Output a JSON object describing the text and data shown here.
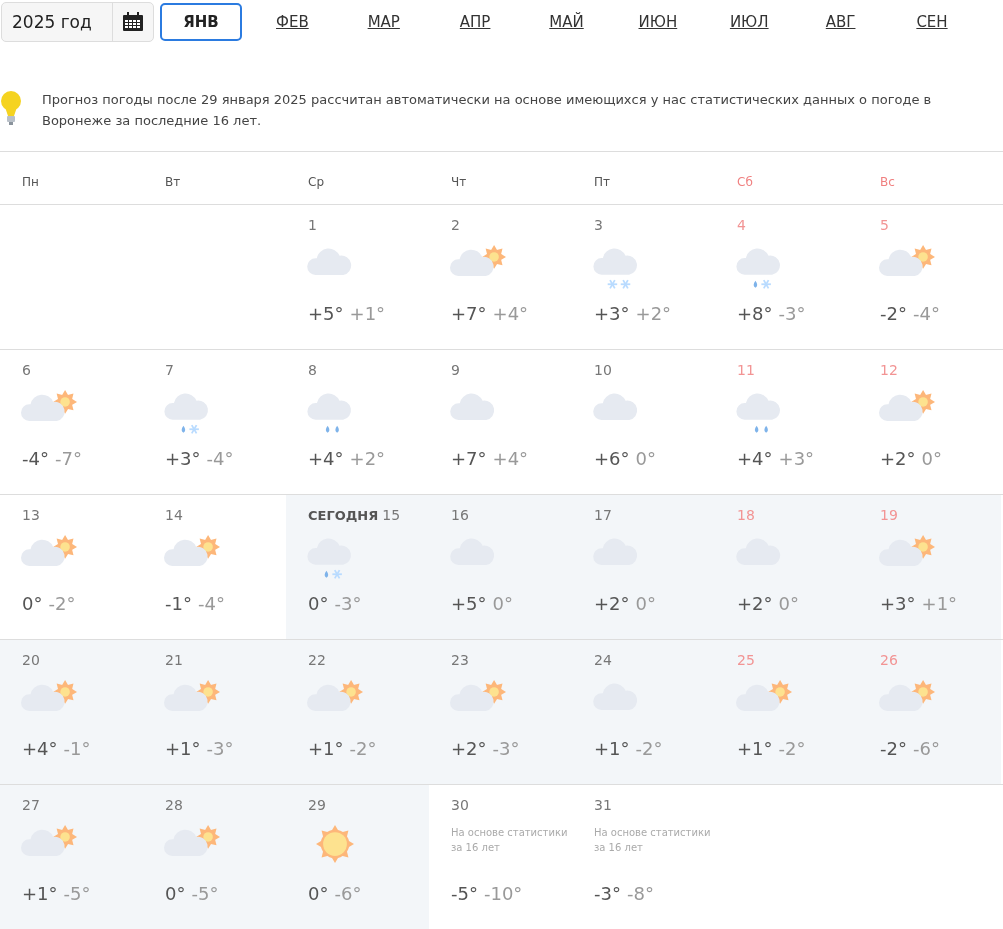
{
  "year_picker": {
    "value": "2025 год"
  },
  "months": [
    {
      "label": "ЯНВ",
      "selected": true
    },
    {
      "label": "ФЕВ",
      "selected": false
    },
    {
      "label": "МАР",
      "selected": false
    },
    {
      "label": "АПР",
      "selected": false
    },
    {
      "label": "МАЙ",
      "selected": false
    },
    {
      "label": "ИЮН",
      "selected": false
    },
    {
      "label": "ИЮЛ",
      "selected": false
    },
    {
      "label": "АВГ",
      "selected": false
    },
    {
      "label": "СЕН",
      "selected": false
    }
  ],
  "notice": "Прогноз погоды после 29 января 2025 рассчитан автоматически на основе имеющихся у нас статистических данных о погоде в Воронеже за последние 16 лет.",
  "weekdays": [
    {
      "label": "Пн",
      "weekend": false
    },
    {
      "label": "Вт",
      "weekend": false
    },
    {
      "label": "Ср",
      "weekend": false
    },
    {
      "label": "Чт",
      "weekend": false
    },
    {
      "label": "Пт",
      "weekend": false
    },
    {
      "label": "Сб",
      "weekend": true
    },
    {
      "label": "Вс",
      "weekend": true
    }
  ],
  "weeks": [
    {
      "kind": "leading",
      "days": [
        {
          "day": "1",
          "weekend": false,
          "highlighted": false,
          "kind": "cloud",
          "high": "+5°",
          "low": "+1°"
        },
        {
          "day": "2",
          "weekend": false,
          "highlighted": false,
          "kind": "partly",
          "high": "+7°",
          "low": "+4°"
        },
        {
          "day": "3",
          "weekend": false,
          "highlighted": false,
          "kind": "snow",
          "high": "+3°",
          "low": "+2°"
        },
        {
          "day": "4",
          "weekend": true,
          "highlighted": false,
          "kind": "sleet",
          "high": "+8°",
          "low": "-3°"
        },
        {
          "day": "5",
          "weekend": true,
          "highlighted": false,
          "kind": "partly",
          "high": "-2°",
          "low": "-4°"
        }
      ]
    },
    {
      "kind": "full",
      "days": [
        {
          "day": "6",
          "weekend": false,
          "highlighted": false,
          "kind": "partly",
          "high": "-4°",
          "low": "-7°"
        },
        {
          "day": "7",
          "weekend": false,
          "highlighted": false,
          "kind": "sleet",
          "high": "+3°",
          "low": "-4°"
        },
        {
          "day": "8",
          "weekend": false,
          "highlighted": false,
          "kind": "rain",
          "high": "+4°",
          "low": "+2°"
        },
        {
          "day": "9",
          "weekend": false,
          "highlighted": false,
          "kind": "cloud",
          "high": "+7°",
          "low": "+4°"
        },
        {
          "day": "10",
          "weekend": false,
          "highlighted": false,
          "kind": "cloud",
          "high": "+6°",
          "low": "0°"
        },
        {
          "day": "11",
          "weekend": true,
          "highlighted": false,
          "kind": "rain",
          "high": "+4°",
          "low": "+3°"
        },
        {
          "day": "12",
          "weekend": true,
          "highlighted": false,
          "kind": "partly",
          "high": "+2°",
          "low": "0°"
        }
      ]
    },
    {
      "kind": "full",
      "days": [
        {
          "day": "13",
          "weekend": false,
          "highlighted": false,
          "kind": "partly",
          "high": "0°",
          "low": "-2°"
        },
        {
          "day": "14",
          "weekend": false,
          "highlighted": false,
          "kind": "partly",
          "high": "-1°",
          "low": "-4°"
        },
        {
          "day": "15",
          "today_label": "СЕГОДНЯ",
          "weekend": false,
          "highlighted": true,
          "kind": "sleet",
          "high": "0°",
          "low": "-3°"
        },
        {
          "day": "16",
          "weekend": false,
          "highlighted": true,
          "kind": "cloud",
          "high": "+5°",
          "low": "0°"
        },
        {
          "day": "17",
          "weekend": false,
          "highlighted": true,
          "kind": "cloud",
          "high": "+2°",
          "low": "0°"
        },
        {
          "day": "18",
          "weekend": true,
          "highlighted": true,
          "kind": "cloud",
          "high": "+2°",
          "low": "0°"
        },
        {
          "day": "19",
          "weekend": true,
          "highlighted": true,
          "kind": "partly",
          "high": "+3°",
          "low": "+1°"
        }
      ]
    },
    {
      "kind": "full",
      "days": [
        {
          "day": "20",
          "weekend": false,
          "highlighted": true,
          "kind": "partly",
          "high": "+4°",
          "low": "-1°"
        },
        {
          "day": "21",
          "weekend": false,
          "highlighted": true,
          "kind": "partly",
          "high": "+1°",
          "low": "-3°"
        },
        {
          "day": "22",
          "weekend": false,
          "highlighted": true,
          "kind": "partly",
          "high": "+1°",
          "low": "-2°"
        },
        {
          "day": "23",
          "weekend": false,
          "highlighted": true,
          "kind": "partly",
          "high": "+2°",
          "low": "-3°"
        },
        {
          "day": "24",
          "weekend": false,
          "highlighted": true,
          "kind": "cloud",
          "high": "+1°",
          "low": "-2°"
        },
        {
          "day": "25",
          "weekend": true,
          "highlighted": true,
          "kind": "partly",
          "high": "+1°",
          "low": "-2°"
        },
        {
          "day": "26",
          "weekend": true,
          "highlighted": true,
          "kind": "partly",
          "high": "-2°",
          "low": "-6°"
        }
      ]
    },
    {
      "kind": "trailing",
      "days": [
        {
          "day": "27",
          "weekend": false,
          "highlighted": true,
          "kind": "partly",
          "high": "+1°",
          "low": "-5°"
        },
        {
          "day": "28",
          "weekend": false,
          "highlighted": true,
          "kind": "partly",
          "high": "0°",
          "low": "-5°"
        },
        {
          "day": "29",
          "weekend": false,
          "highlighted": true,
          "kind": "sun",
          "high": "0°",
          "low": "-6°"
        },
        {
          "day": "30",
          "weekend": false,
          "highlighted": false,
          "kind": "statistics",
          "note": "На основе статистики за 16 лет",
          "high": "-5°",
          "low": "-10°"
        },
        {
          "day": "31",
          "weekend": false,
          "highlighted": false,
          "kind": "statistics",
          "note": "На основе статистики за 16 лет",
          "high": "-3°",
          "low": "-8°"
        }
      ]
    }
  ]
}
